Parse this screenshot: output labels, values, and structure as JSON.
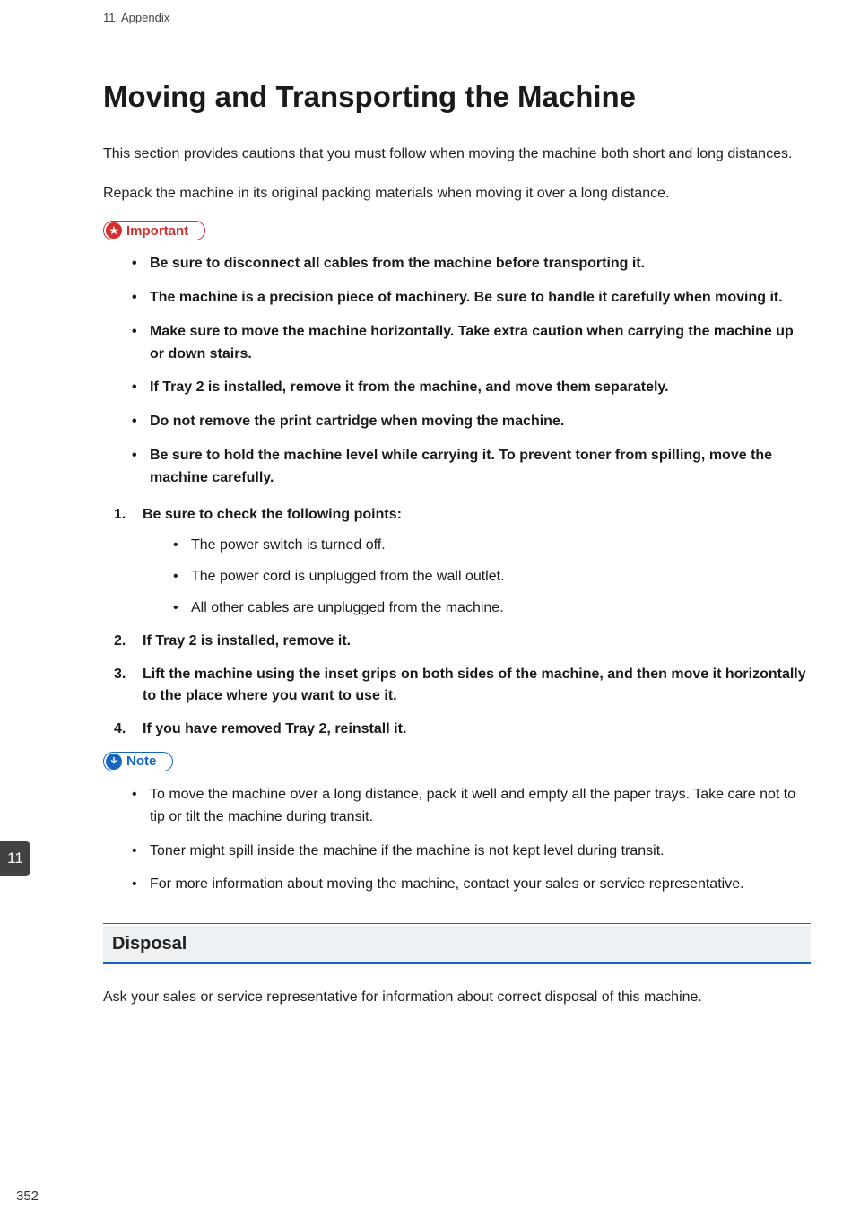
{
  "header": {
    "running": "11. Appendix"
  },
  "title": "Moving and Transporting the Machine",
  "intro": [
    "This section provides cautions that you must follow when moving the machine both short and long distances.",
    "Repack the machine in its original packing materials when moving it over a long distance."
  ],
  "callouts": {
    "important_label": "Important",
    "note_label": "Note"
  },
  "important_items": [
    "Be sure to disconnect all cables from the machine before transporting it.",
    "The machine is a precision piece of machinery. Be sure to handle it carefully when moving it.",
    "Make sure to move the machine horizontally. Take extra caution when carrying the machine up or down stairs.",
    "If Tray 2 is installed, remove it from the machine, and move them separately.",
    "Do not remove the print cartridge when moving the machine.",
    "Be sure to hold the machine level while carrying it. To prevent toner from spilling, move the machine carefully."
  ],
  "steps": [
    {
      "text": "Be sure to check the following points:",
      "sub": [
        "The power switch is turned off.",
        "The power cord is unplugged from the wall outlet.",
        "All other cables are unplugged from the machine."
      ]
    },
    {
      "text": "If Tray 2 is installed, remove it."
    },
    {
      "text": "Lift the machine using the inset grips on both sides of the machine, and then move it horizontally to the place where you want to use it."
    },
    {
      "text": "If you have removed Tray 2, reinstall it."
    }
  ],
  "note_items": [
    "To move the machine over a long distance, pack it well and empty all the paper trays. Take care not to tip or tilt the machine during transit.",
    "Toner might spill inside the machine if the machine is not kept level during transit.",
    "For more information about moving the machine, contact your sales or service representative."
  ],
  "section": {
    "heading": "Disposal",
    "text": "Ask your sales or service representative for information about correct disposal of this machine."
  },
  "side_tab": "11",
  "page_number": "352"
}
